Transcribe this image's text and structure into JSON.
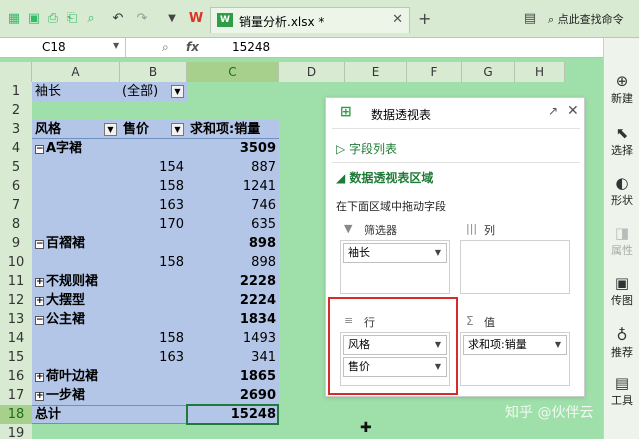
{
  "toolbar": {
    "tab_title": "销量分析.xlsx *",
    "tab_logo": "W",
    "search_label": "点此查找命令"
  },
  "formula_bar": {
    "name_box": "C18",
    "fx_label": "fx",
    "value": "15248"
  },
  "columns": [
    "A",
    "B",
    "C",
    "D",
    "E",
    "F",
    "G",
    "H"
  ],
  "rows": [
    "1",
    "2",
    "3",
    "4",
    "5",
    "6",
    "7",
    "8",
    "9",
    "10",
    "11",
    "12",
    "13",
    "14",
    "15",
    "16",
    "17",
    "18",
    "19"
  ],
  "pivot": {
    "filter_label": "袖长",
    "filter_value": "(全部)",
    "header_style": "风格",
    "header_price": "售价",
    "header_sum": "求和项:销量",
    "r4_a": "A字裙",
    "r4_c": "3509",
    "r5_b": "154",
    "r5_c": "887",
    "r6_b": "158",
    "r6_c": "1241",
    "r7_b": "163",
    "r7_c": "746",
    "r8_b": "170",
    "r8_c": "635",
    "r9_a": "百褶裙",
    "r9_c": "898",
    "r10_b": "158",
    "r10_c": "898",
    "r11_a": "不规则裙",
    "r11_c": "2228",
    "r12_a": "大摆型",
    "r12_c": "2224",
    "r13_a": "公主裙",
    "r13_c": "1834",
    "r14_b": "158",
    "r14_c": "1493",
    "r15_b": "163",
    "r15_c": "341",
    "r16_a": "荷叶边裙",
    "r16_c": "1865",
    "r17_a": "一步裙",
    "r17_c": "2690",
    "total_label": "总计",
    "total_value": "15248"
  },
  "panel": {
    "title": "数据透视表",
    "field_list": "字段列表",
    "areas_title": "数据透视表区域",
    "hint": "在下面区域中拖动字段",
    "filter_area": "筛选器",
    "column_area": "列",
    "row_area": "行",
    "value_area": "值",
    "filter_field": "袖长",
    "row_field_1": "风格",
    "row_field_2": "售价",
    "value_field": "求和项:销量"
  },
  "sidebar": {
    "items": [
      "新建",
      "选择",
      "形状",
      "属性",
      "传图",
      "推荐",
      "工具"
    ]
  },
  "watermark": "知乎 @伙伴云"
}
